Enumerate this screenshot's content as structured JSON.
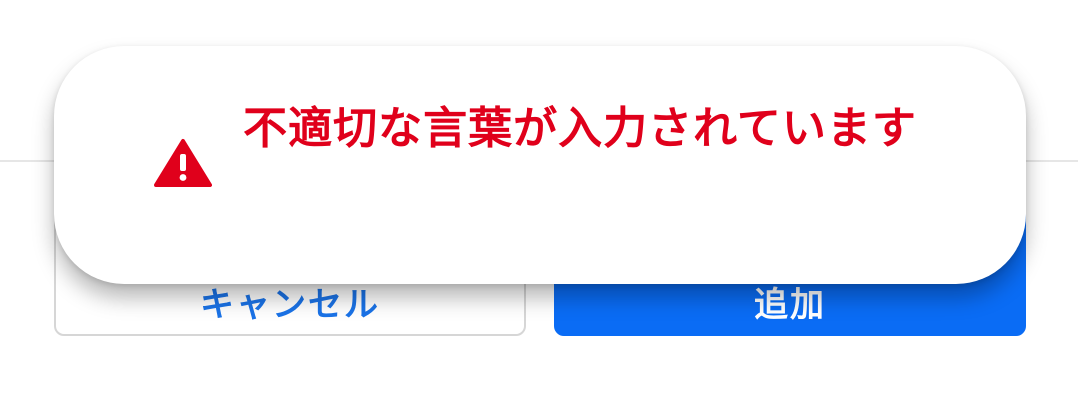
{
  "toast": {
    "message": "不適切な言葉が入力されています",
    "icon": "warning-icon",
    "color": "#e0001b"
  },
  "buttons": {
    "cancel_label": "キャンセル",
    "confirm_label": "追加"
  },
  "colors": {
    "primary": "#0a6cf5",
    "error": "#e0001b"
  }
}
